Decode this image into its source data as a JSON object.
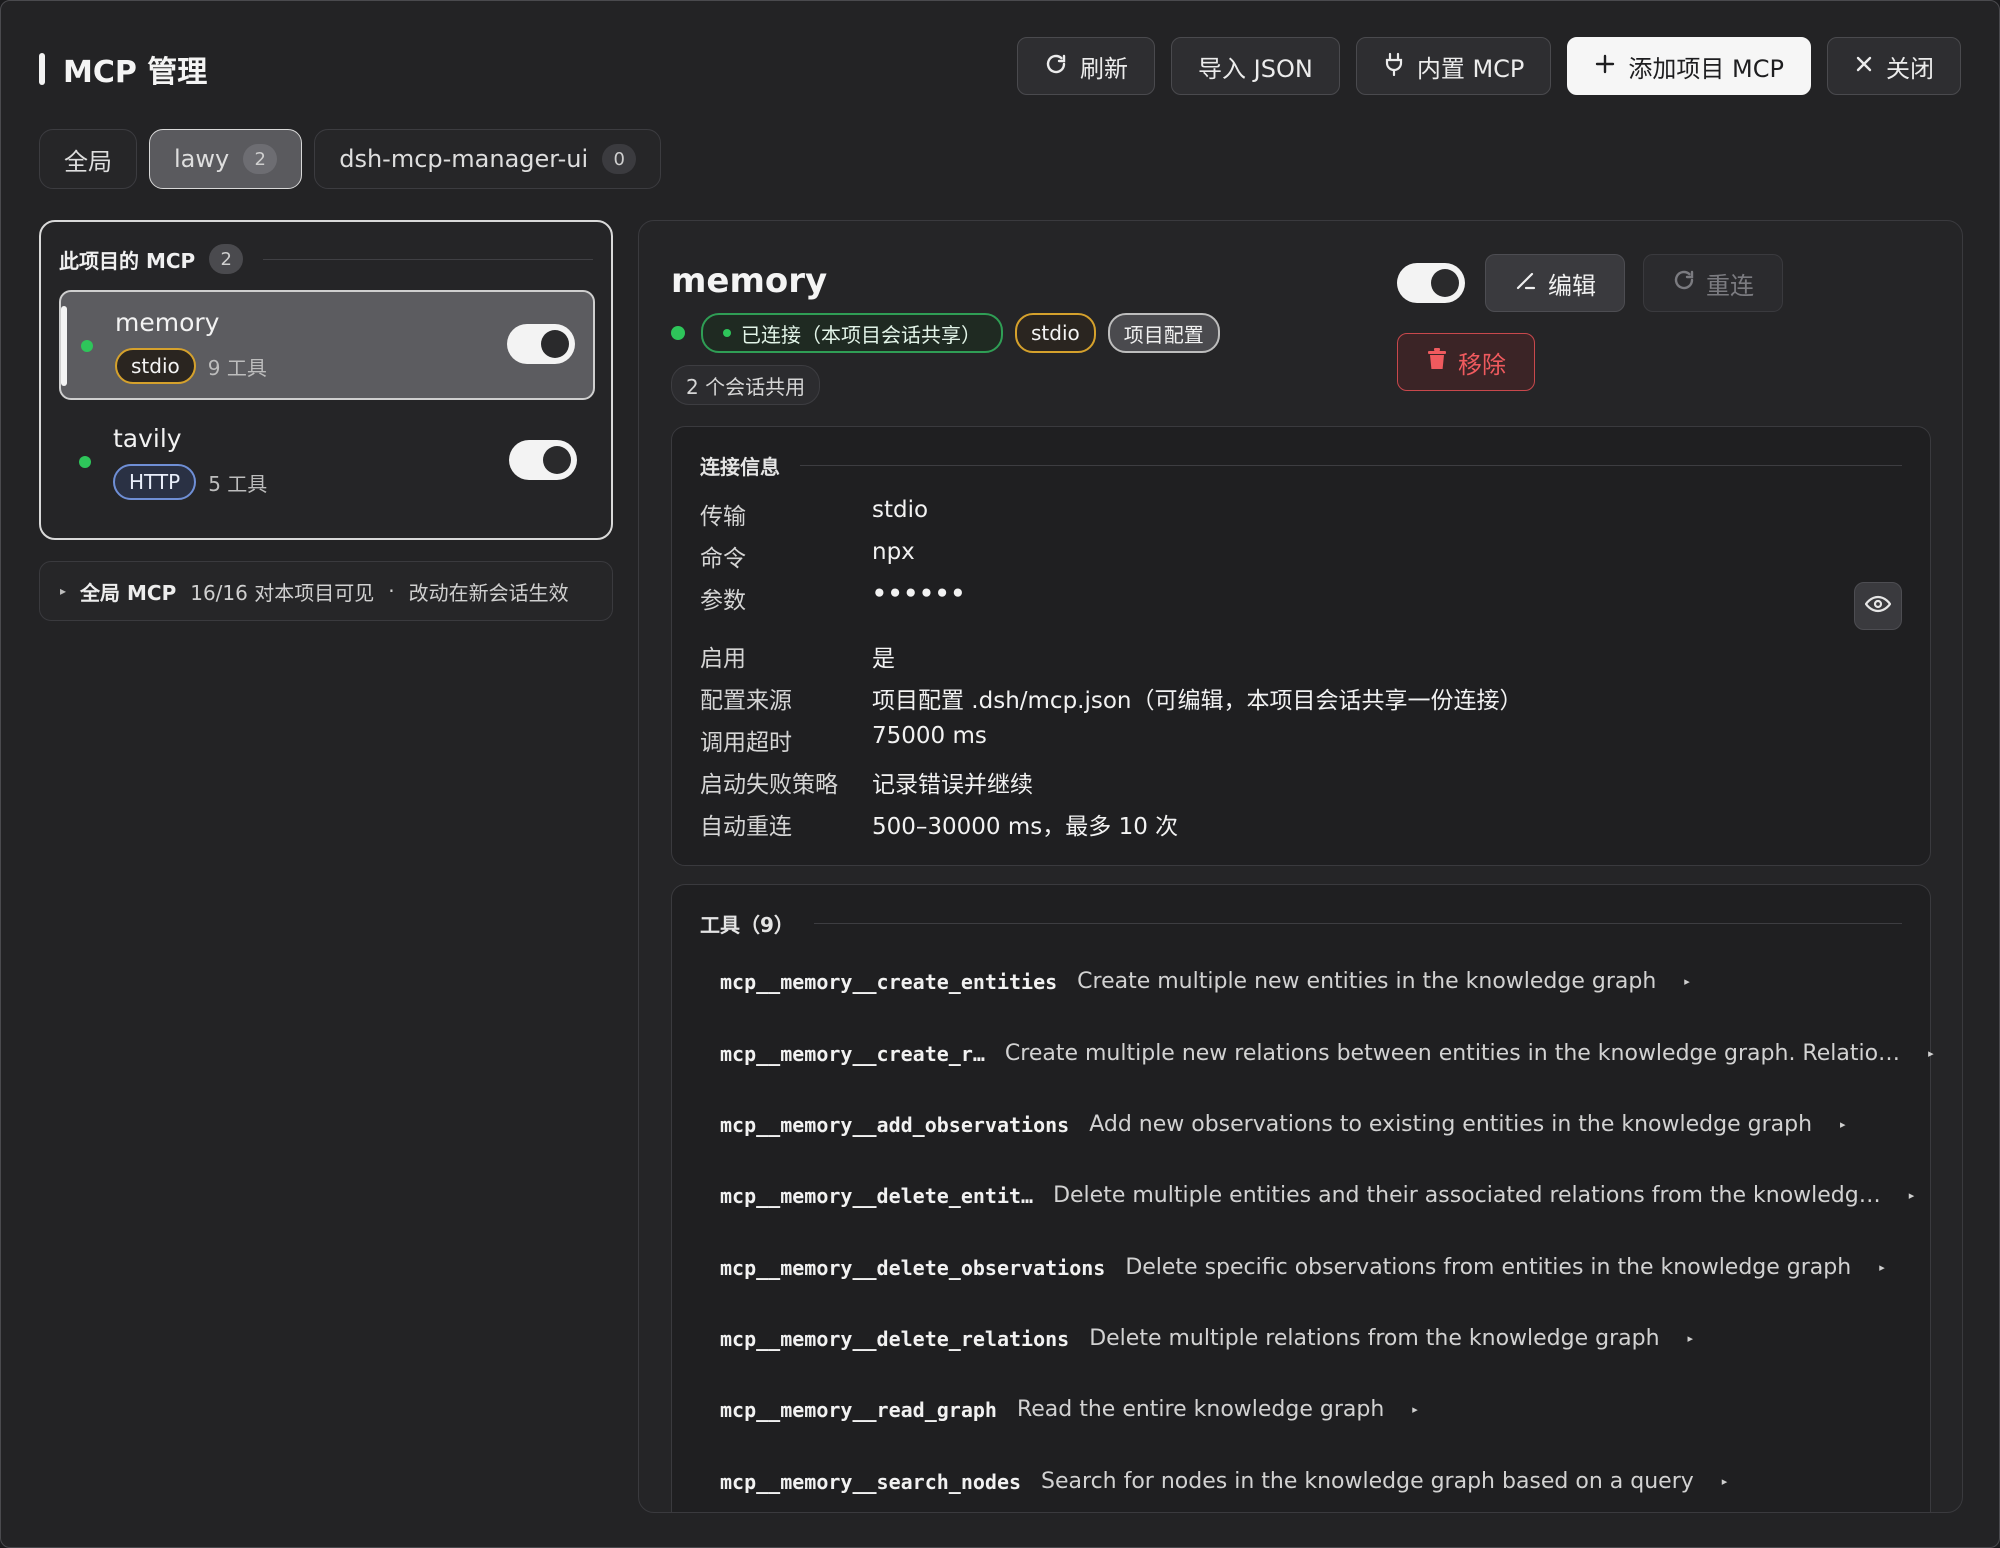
{
  "header": {
    "title": "MCP 管理",
    "buttons": {
      "refresh": "刷新",
      "import_json": "导入 JSON",
      "builtin": "内置 MCP",
      "add_project": "添加项目 MCP",
      "close": "关闭"
    }
  },
  "scopes": [
    {
      "label": "全局"
    },
    {
      "label": "lawy",
      "count": "2"
    },
    {
      "label": "dsh-mcp-manager-ui",
      "count": "0"
    }
  ],
  "project_panel": {
    "heading": "此项目的 MCP",
    "count": "2",
    "servers": [
      {
        "name": "memory",
        "transport": "stdio",
        "tools": "9 工具"
      },
      {
        "name": "tavily",
        "transport": "HTTP",
        "tools": "5 工具"
      }
    ]
  },
  "global_row": {
    "label": "全局 MCP",
    "visible": "16/16 对本项目可见",
    "separator": "·",
    "note": "改动在新会话生效"
  },
  "detail": {
    "name": "memory",
    "status": "已连接（本项目会话共享）",
    "transport": "stdio",
    "source_badge": "项目配置",
    "shared": "2 个会话共用",
    "buttons": {
      "edit": "编辑",
      "reconnect": "重连",
      "remove": "移除"
    },
    "connection": {
      "heading": "连接信息",
      "rows": [
        {
          "k": "传输",
          "v": "stdio"
        },
        {
          "k": "命令",
          "v": "npx"
        },
        {
          "k": "参数",
          "v": "••••••"
        },
        {
          "k": "启用",
          "v": "是"
        },
        {
          "k": "配置来源",
          "v": "项目配置 .dsh/mcp.json（可编辑，本项目会话共享一份连接）"
        },
        {
          "k": "调用超时",
          "v": "75000 ms"
        },
        {
          "k": "启动失败策略",
          "v": "记录错误并继续"
        },
        {
          "k": "自动重连",
          "v": "500–30000 ms，最多 10 次"
        }
      ]
    },
    "tools": {
      "heading": "工具（9）",
      "items": [
        {
          "name": "mcp__memory__create_entities",
          "desc": "Create multiple new entities in the knowledge graph"
        },
        {
          "name": "mcp__memory__create_r…",
          "desc": "Create multiple new relations between entities in the knowledge graph. Relatio…"
        },
        {
          "name": "mcp__memory__add_observations",
          "desc": "Add new observations to existing entities in the knowledge graph"
        },
        {
          "name": "mcp__memory__delete_entit…",
          "desc": "Delete multiple entities and their associated relations from the knowledg…"
        },
        {
          "name": "mcp__memory__delete_observations",
          "desc": "Delete specific observations from entities in the knowledge graph"
        },
        {
          "name": "mcp__memory__delete_relations",
          "desc": "Delete multiple relations from the knowledge graph"
        },
        {
          "name": "mcp__memory__read_graph",
          "desc": "Read the entire knowledge graph"
        },
        {
          "name": "mcp__memory__search_nodes",
          "desc": "Search for nodes in the knowledge graph based on a query"
        }
      ]
    }
  },
  "colors": {
    "accent_green": "#2ec55a",
    "stdio_border": "#d5a12c",
    "http_border": "#6f8fd6",
    "danger": "#ef5a5e"
  }
}
